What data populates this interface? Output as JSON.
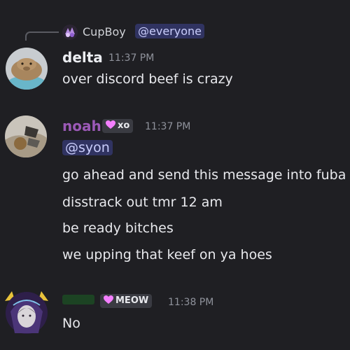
{
  "reply": {
    "author": "CupBoy",
    "mention": "@everyone"
  },
  "messages": [
    {
      "username": "delta",
      "username_color": "#f2f3f5",
      "timestamp": "11:37 PM",
      "lines": [
        "over discord beef is crazy"
      ]
    },
    {
      "username": "noah",
      "username_color": "#9b59b6",
      "tag": "xo",
      "timestamp": "11:37 PM",
      "mention": "@syon",
      "lines": [
        "go ahead and send this message into fuba",
        "disstrack out tmr 12 am",
        "be ready bitches",
        "we upping that keef on ya hoes"
      ]
    },
    {
      "username": "",
      "username_color": "#1f6b2a",
      "tag": "MEOW",
      "timestamp": "11:38 PM",
      "lines": [
        "No"
      ]
    }
  ],
  "colors": {
    "background": "#1f1f23",
    "mention_bg": "#3b3f78",
    "mention_text": "#c9cdfb",
    "tag_heart": "#f47fff"
  }
}
